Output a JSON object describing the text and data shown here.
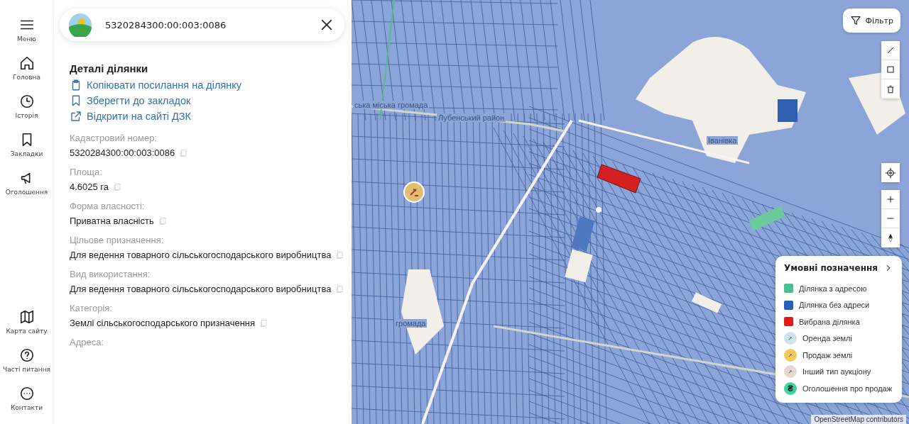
{
  "nav": [
    {
      "label": "Меню"
    },
    {
      "label": "Головна"
    },
    {
      "label": "Історія"
    },
    {
      "label": "Закладки"
    },
    {
      "label": "Оголошення"
    },
    {
      "label": "Карта сайту"
    },
    {
      "label": "Часті питання"
    },
    {
      "label": "Контакти"
    }
  ],
  "search": {
    "value": "5320284300:00:003:0086"
  },
  "details": {
    "title": "Деталі ділянки",
    "actions": [
      {
        "label": "Копіювати посилання на ділянку"
      },
      {
        "label": "Зберегти до закладок"
      },
      {
        "label": "Відкрити на сайті ДЗК"
      }
    ],
    "fields": [
      {
        "label": "Кадастровий номер:",
        "value": "5320284300:00:003:0086"
      },
      {
        "label": "Площа:",
        "value": "4.6025 га"
      },
      {
        "label": "Форма власності:",
        "value": "Приватна власність"
      },
      {
        "label": "Цільове призначення:",
        "value": "Для ведення товарного сільськогосподарського виробництва"
      },
      {
        "label": "Вид використання:",
        "value": "Для ведення товарного сільськогосподарського виробництва"
      },
      {
        "label": "Категорія:",
        "value": "Землі сільськогосподарського призначення"
      },
      {
        "label": "Адреса:"
      }
    ]
  },
  "map": {
    "labels": [
      "Іванівка",
      "ська міська громада",
      "Лубенський район",
      "громада"
    ],
    "filter_button": "Фільтр",
    "legend": {
      "title": "Умовні позначення",
      "items": [
        {
          "kind": "swatch",
          "label": "Ділянка з адресою",
          "color": "#4dbd8f"
        },
        {
          "kind": "swatch",
          "label": "Ділянка без адреси",
          "color": "#2a5fb8"
        },
        {
          "kind": "swatch",
          "label": "Вибрана ділянка",
          "color": "#e01b1b"
        },
        {
          "kind": "marker",
          "label": "Оренда землі",
          "color": "#cfe3ee"
        },
        {
          "kind": "marker",
          "label": "Продаж землі",
          "color": "#f3c95a"
        },
        {
          "kind": "marker",
          "label": "Інший тип аукціону",
          "color": "#e5d8d0"
        },
        {
          "kind": "symbol",
          "label": "Оголошення про продаж",
          "color": "#3fd3a0",
          "symbol": "₴"
        }
      ]
    },
    "attribution": "OpenStreetMap contributors"
  }
}
